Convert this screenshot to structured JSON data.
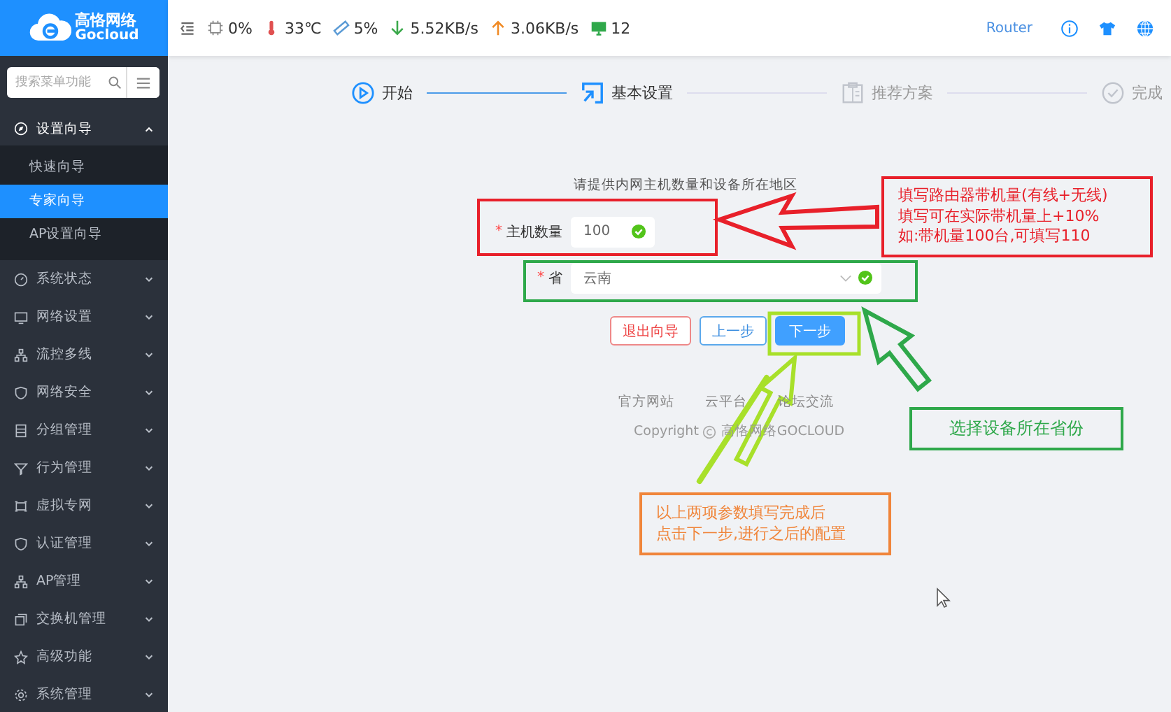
{
  "logo": {
    "name": "高恪网络",
    "sub": "Gocloud"
  },
  "topbar": {
    "stats": [
      {
        "kind": "cpu",
        "value": "0%"
      },
      {
        "kind": "temp",
        "value": "33℃"
      },
      {
        "kind": "mem",
        "value": "5%"
      },
      {
        "kind": "down",
        "value": "5.52KB/s"
      },
      {
        "kind": "up",
        "value": "3.06KB/s"
      },
      {
        "kind": "hosts",
        "value": "12"
      }
    ],
    "device": "Router"
  },
  "sidebar": {
    "search": {
      "placeholder": "搜索菜单功能"
    },
    "items": [
      {
        "label": "设置向导",
        "expanded": true,
        "children": [
          {
            "label": "快速向导",
            "selected": false
          },
          {
            "label": "专家向导",
            "selected": true
          },
          {
            "label": "AP设置向导",
            "selected": false
          }
        ]
      },
      {
        "label": "系统状态",
        "expanded": false
      },
      {
        "label": "网络设置",
        "expanded": false
      },
      {
        "label": "流控多线",
        "expanded": false
      },
      {
        "label": "网络安全",
        "expanded": false
      },
      {
        "label": "分组管理",
        "expanded": false
      },
      {
        "label": "行为管理",
        "expanded": false
      },
      {
        "label": "虚拟专网",
        "expanded": false
      },
      {
        "label": "认证管理",
        "expanded": false
      },
      {
        "label": "AP管理",
        "expanded": false
      },
      {
        "label": "交换机管理",
        "expanded": false
      },
      {
        "label": "高级功能",
        "expanded": false
      },
      {
        "label": "系统管理",
        "expanded": false
      }
    ]
  },
  "steps": [
    {
      "label": "开始",
      "completed": true,
      "current": false
    },
    {
      "label": "基本设置",
      "completed": false,
      "current": true
    },
    {
      "label": "推荐方案",
      "completed": false,
      "current": false
    },
    {
      "label": "完成",
      "completed": false,
      "current": false
    }
  ],
  "form": {
    "heading": "请提供内网主机数量和设备所在地区",
    "required_mark": "*",
    "fields": [
      {
        "kind": "input",
        "label": "主机数量",
        "value": "100",
        "required": true,
        "valid": true
      },
      {
        "kind": "select",
        "label": "省",
        "value": "云南",
        "required": true,
        "valid": true
      }
    ],
    "buttons": [
      {
        "kind": "exit",
        "label": "退出向导"
      },
      {
        "kind": "prev",
        "label": "上一步"
      },
      {
        "kind": "next",
        "label": "下一步"
      }
    ]
  },
  "footer": {
    "links": [
      "官方网站",
      "云平台",
      "论坛交流"
    ],
    "copyright": "Copyright",
    "company": "高恪网络GOCLOUD"
  },
  "notes": [
    {
      "color": "#e8202a",
      "lines": [
        "填写路由器带机量(有线+无线)",
        "填写可在实际带机量上+10%",
        "如:带机量100台,可填写110"
      ]
    },
    {
      "color": "#2ea84a",
      "lines": [
        "选择设备所在省份"
      ]
    },
    {
      "color": "#f0853a",
      "lines": [
        "以上两项参数填写完成后",
        "点击下一步,进行之后的配置"
      ]
    }
  ]
}
